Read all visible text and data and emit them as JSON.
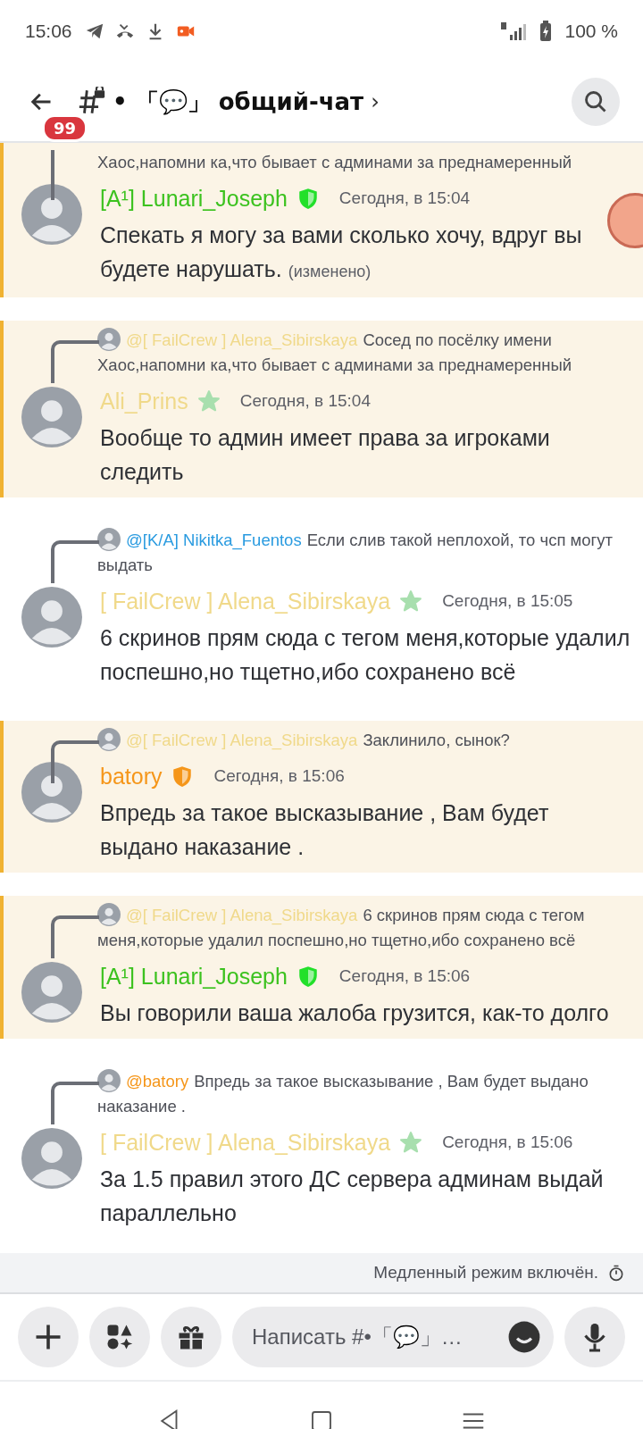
{
  "status_bar": {
    "time": "15:06",
    "battery": "100 %"
  },
  "header": {
    "unread_count": "99",
    "channel": "• 「💬」 общий-чат",
    "chevron": "›"
  },
  "messages": [
    {
      "highlighted": true,
      "reply": {
        "text": "Хаос,напомни ка,что бывает с админами за преднамеренный"
      },
      "author": {
        "name": "[A¹] Lunari_Joseph",
        "color": "#3cc21f"
      },
      "badge": {
        "kind": "shield",
        "color": "#22e02a"
      },
      "time": "Сегодня, в 15:04",
      "text": "Спекать я могу за вами сколько хочу, вдруг вы будете нарушать.",
      "edited": "(изменено)"
    },
    {
      "highlighted": true,
      "reply": {
        "author": {
          "name": "@[ FailCrew ] Alena_Sibirskaya",
          "color": "#f0d98a"
        },
        "text": "Сосед по посёлку имени Хаос,напомни ка,что бывает с админами за преднамеренный"
      },
      "author": {
        "name": "Ali_Prins",
        "color": "#f0d98a"
      },
      "badge": {
        "kind": "star",
        "color": "#a8dfae"
      },
      "time": "Сегодня, в 15:04",
      "text": "Вообще то админ имеет права за игроками следить"
    },
    {
      "highlighted": false,
      "reply": {
        "author": {
          "name": "@[K/A] Nikitka_Fuentos",
          "color": "#2a9be0"
        },
        "text": "Если слив такой неплохой, то чсп могут выдать"
      },
      "author": {
        "name": "[ FailCrew ] Alena_Sibirskaya",
        "color": "#f0d98a"
      },
      "badge": {
        "kind": "star",
        "color": "#a8dfae"
      },
      "time": "Сегодня, в 15:05",
      "text": "6 скринов прям сюда с тегом меня,которые удалил поспешно,но тщетно,ибо сохранено всё"
    },
    {
      "highlighted": true,
      "reply": {
        "author": {
          "name": "@[ FailCrew ] Alena_Sibirskaya",
          "color": "#f0d98a"
        },
        "text": "Заклинило, сынок?"
      },
      "author": {
        "name": "batory",
        "color": "#f5961a"
      },
      "badge": {
        "kind": "shield",
        "color": "#f5961a"
      },
      "time": "Сегодня, в 15:06",
      "text": "Впредь за такое высказывание , Вам будет выдано наказание ."
    },
    {
      "highlighted": true,
      "reply": {
        "author": {
          "name": "@[ FailCrew ] Alena_Sibirskaya",
          "color": "#f0d98a"
        },
        "text": "6 скринов прям сюда с тегом меня,которые удалил поспешно,но тщетно,ибо сохранено всё"
      },
      "author": {
        "name": "[A¹] Lunari_Joseph",
        "color": "#3cc21f"
      },
      "badge": {
        "kind": "shield",
        "color": "#22e02a"
      },
      "time": "Сегодня, в 15:06",
      "text": "Вы говорили ваша жалоба грузится, как-то долго"
    },
    {
      "highlighted": false,
      "reply": {
        "author": {
          "name": "@batory",
          "color": "#f5961a"
        },
        "text": "Впредь за такое высказывание , Вам будет выдано наказание ."
      },
      "author": {
        "name": "[ FailCrew ] Alena_Sibirskaya",
        "color": "#f0d98a"
      },
      "badge": {
        "kind": "star",
        "color": "#a8dfae"
      },
      "time": "Сегодня, в 15:06",
      "text": "За 1.5 правил этого ДС сервера админам выдай параллельно"
    }
  ],
  "slow_mode": "Медленный режим включён.",
  "composer": {
    "placeholder": "Написать #•「💬」…"
  }
}
